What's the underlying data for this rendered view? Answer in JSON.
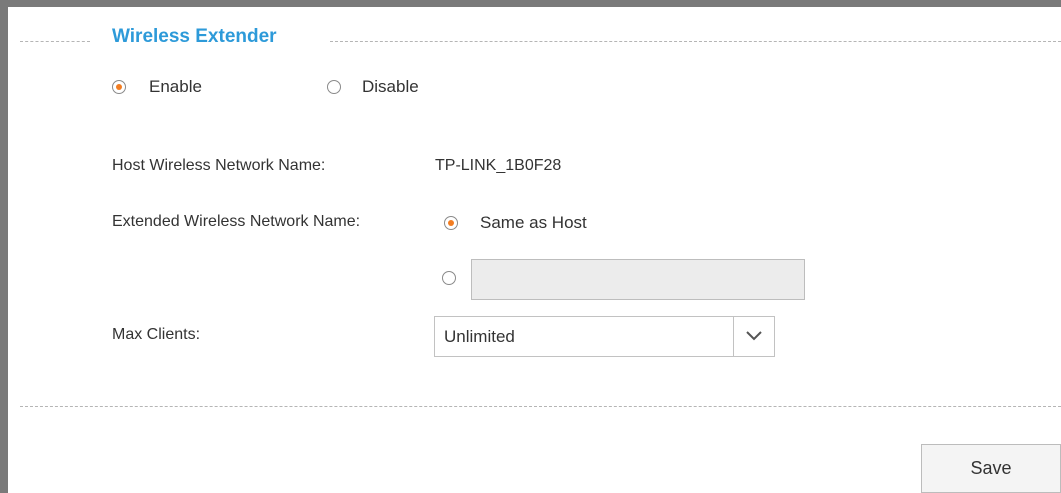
{
  "section": {
    "title": "Wireless Extender"
  },
  "extender": {
    "options": [
      {
        "label": "Enable",
        "checked": true
      },
      {
        "label": "Disable",
        "checked": false
      }
    ]
  },
  "host": {
    "label": "Host Wireless Network Name:",
    "value": "TP-LINK_1B0F28"
  },
  "extended": {
    "label": "Extended Wireless Network Name:",
    "same_as_host_label": "Same as Host",
    "same_as_host_checked": true,
    "custom_checked": false,
    "custom_value": "",
    "custom_placeholder": ""
  },
  "max_clients": {
    "label": "Max Clients:",
    "selected": "Unlimited"
  },
  "actions": {
    "save_label": "Save"
  },
  "colors": {
    "accent": "#2d9ad9",
    "radio_checked": "#f27d22"
  }
}
